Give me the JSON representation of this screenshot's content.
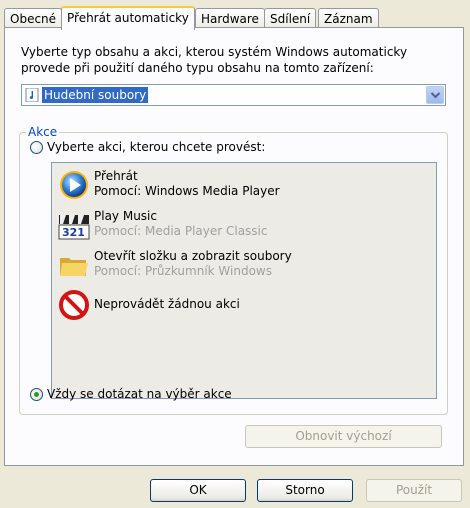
{
  "tabs": [
    {
      "label": "Obecné",
      "active": false
    },
    {
      "label": "Přehrát automaticky",
      "active": true
    },
    {
      "label": "Hardware",
      "active": false
    },
    {
      "label": "Sdílení",
      "active": false
    },
    {
      "label": "Záznam",
      "active": false
    }
  ],
  "description": "Vyberte typ obsahu a akci, kterou systém Windows automaticky provede při použití daného typu obsahu na tomto zařízení:",
  "content_type": {
    "selected": "Hudební soubory",
    "icon": "music-file-icon"
  },
  "actions_group": {
    "legend": "Akce",
    "choose_radio": {
      "label": "Vyberte akci, kterou chcete provést:",
      "checked": false
    },
    "actions": [
      {
        "title": "Přehrát",
        "subtitle": "Pomocí: Windows Media Player",
        "icon": "windows-media-player-icon"
      },
      {
        "title": "Play Music",
        "subtitle": "Pomocí: Media Player Classic",
        "icon": "media-player-classic-icon"
      },
      {
        "title": "Otevřít složku a zobrazit soubory",
        "subtitle": "Pomocí: Průzkumník Windows",
        "icon": "folder-icon"
      },
      {
        "title": "Neprovádět žádnou akci",
        "subtitle": "",
        "icon": "no-action-icon"
      }
    ],
    "always_ask_radio": {
      "label": "Vždy se dotázat na výběr akce",
      "checked": true
    }
  },
  "buttons": {
    "restore_defaults": "Obnovit výchozí",
    "ok": "OK",
    "cancel": "Storno",
    "apply": "Použít"
  },
  "colors": {
    "accent": "#316ac5",
    "legend": "#0046d5",
    "tab_highlight": "#ffc83c"
  }
}
